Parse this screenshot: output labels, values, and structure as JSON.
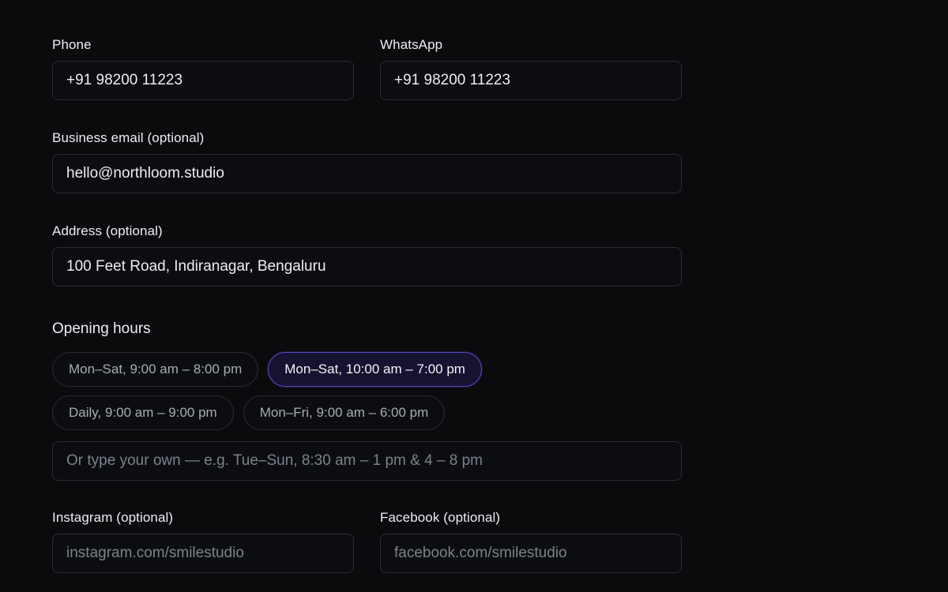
{
  "phone": {
    "label": "Phone",
    "value": "+91 98200 11223"
  },
  "whatsapp": {
    "label": "WhatsApp",
    "value": "+91 98200 11223"
  },
  "email": {
    "label": "Business email (optional)",
    "value": "hello@northloom.studio"
  },
  "address": {
    "label": "Address (optional)",
    "value": "100 Feet Road, Indiranagar, Bengaluru"
  },
  "hours": {
    "label": "Opening hours",
    "presets": [
      {
        "label": "Mon–Sat, 9:00 am – 8:00 pm",
        "selected": false
      },
      {
        "label": "Mon–Sat, 10:00 am – 7:00 pm",
        "selected": true
      },
      {
        "label": "Daily, 9:00 am – 9:00 pm",
        "selected": false
      },
      {
        "label": "Mon–Fri, 9:00 am – 6:00 pm",
        "selected": false
      }
    ],
    "custom_placeholder": "Or type your own — e.g. Tue–Sun, 8:30 am – 1 pm & 4 – 8 pm",
    "custom_value": ""
  },
  "instagram": {
    "label": "Instagram (optional)",
    "placeholder": "instagram.com/smilestudio",
    "value": ""
  },
  "facebook": {
    "label": "Facebook (optional)",
    "placeholder": "facebook.com/smilestudio",
    "value": ""
  },
  "colors": {
    "background": "#0a0b0d",
    "accent": "#5b46c9"
  }
}
